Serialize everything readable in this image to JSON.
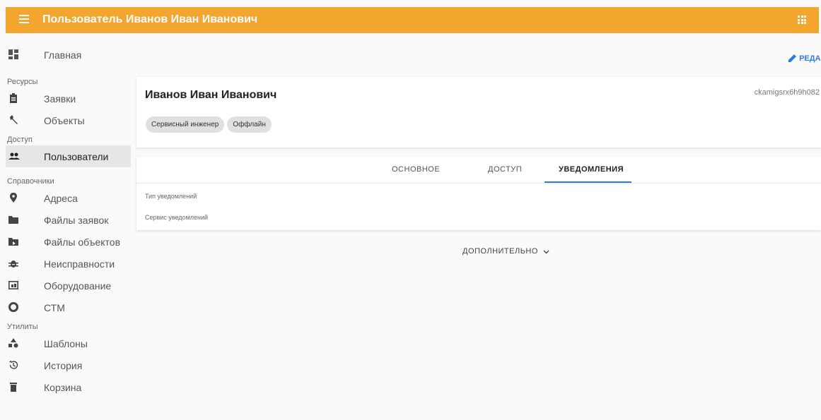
{
  "header": {
    "title": "Пользователь Иванов Иван Иванович",
    "menu_icon": "menu-icon",
    "apps_icon": "apps-grid-icon",
    "color": "#f2a62e"
  },
  "sidebar": {
    "top_item": {
      "label": "Главная",
      "icon": "dashboard-icon"
    },
    "sections": {
      "resources": "Ресурсы",
      "access": "Доступ",
      "references": "Справочники",
      "utilities": "Утилиты"
    },
    "items": {
      "requests": {
        "label": "Заявки",
        "icon": "clipboard-icon"
      },
      "objects": {
        "label": "Объекты",
        "icon": "wrench-icon"
      },
      "users": {
        "label": "Пользователи",
        "icon": "people-icon"
      },
      "addresses": {
        "label": "Адреса",
        "icon": "location-pin-icon"
      },
      "request_files": {
        "label": "Файлы заявок",
        "icon": "folder-icon"
      },
      "object_files": {
        "label": "Файлы объектов",
        "icon": "folder-shared-icon"
      },
      "faults": {
        "label": "Неисправности",
        "icon": "bug-icon"
      },
      "equipment": {
        "label": "Оборудование",
        "icon": "devices-icon"
      },
      "ctm": {
        "label": "СТМ",
        "icon": "donut-icon"
      },
      "templates": {
        "label": "Шаблоны",
        "icon": "shapes-icon"
      },
      "history": {
        "label": "История",
        "icon": "history-icon"
      },
      "trash": {
        "label": "Корзина",
        "icon": "trash-icon"
      }
    }
  },
  "edit_label": "РЕДА",
  "profile": {
    "name": "Иванов Иван Иванович",
    "id": "ckamigsrx6h9h082",
    "chips": {
      "role": "Сервисный инженер",
      "status": "Оффлайн"
    }
  },
  "tabs": {
    "main": "ОСНОВНОЕ",
    "access": "ДОСТУП",
    "notifications": "УВЕДОМЛЕНИЯ"
  },
  "fields": {
    "notify_type": "Тип уведомлений",
    "notify_service": "Сервис уведомлений"
  },
  "more_label": "ДОПОЛНИТЕЛЬНО",
  "accent": "#2c7be5"
}
